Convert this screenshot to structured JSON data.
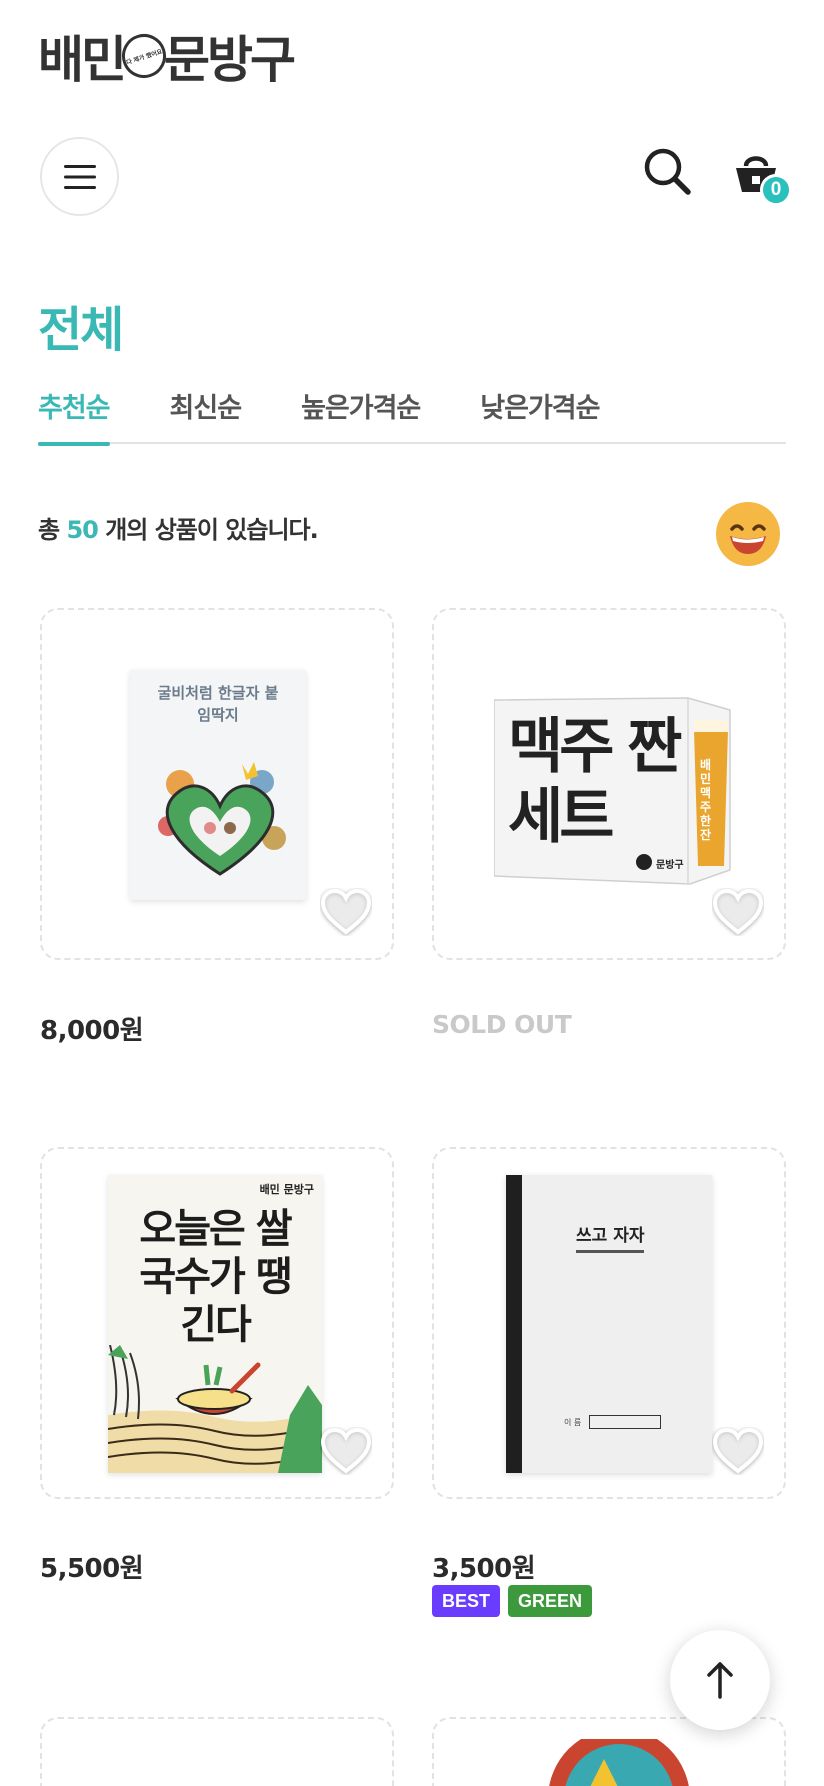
{
  "brand": {
    "logo_left": "배민",
    "logo_right": "문방구",
    "logo_badge": "다 제가 했어요"
  },
  "header": {
    "cart_count": "0"
  },
  "page": {
    "title": "전체"
  },
  "sort_tabs": [
    {
      "label": "추천순",
      "active": true
    },
    {
      "label": "최신순",
      "active": false
    },
    {
      "label": "높은가격순",
      "active": false
    },
    {
      "label": "낮은가격순",
      "active": false
    }
  ],
  "summary": {
    "prefix": "총 ",
    "count": "50",
    "suffix": " 개의 상품이 있습니다."
  },
  "products": [
    {
      "art_text": "굴비처럼 한글자 붙임딱지",
      "price": "8,000원",
      "sold_out": false,
      "badges": []
    },
    {
      "art_text": "맥주 짠세트",
      "art_brand": "문방구",
      "art_side": "배민 맥주 한잔",
      "price": "SOLD OUT",
      "sold_out": true,
      "badges": []
    },
    {
      "art_text": "오늘은 쌀국수가 땡긴다",
      "art_brand": "배민 문방구",
      "price": "5,500원",
      "sold_out": false,
      "badges": []
    },
    {
      "art_text": "쓰고 자자",
      "art_label": "이 름",
      "price": "3,500원",
      "sold_out": false,
      "badges": [
        "BEST",
        "GREEN"
      ]
    }
  ],
  "colors": {
    "accent": "#3ab8b4",
    "best_badge": "#6a3cff",
    "green_badge": "#3c9a3c",
    "sold_out": "#c9c9c9"
  },
  "icons": [
    "hamburger-menu-icon",
    "search-icon",
    "cart-basket-icon",
    "smile-emoji-icon",
    "heart-outline-icon",
    "arrow-up-icon"
  ]
}
